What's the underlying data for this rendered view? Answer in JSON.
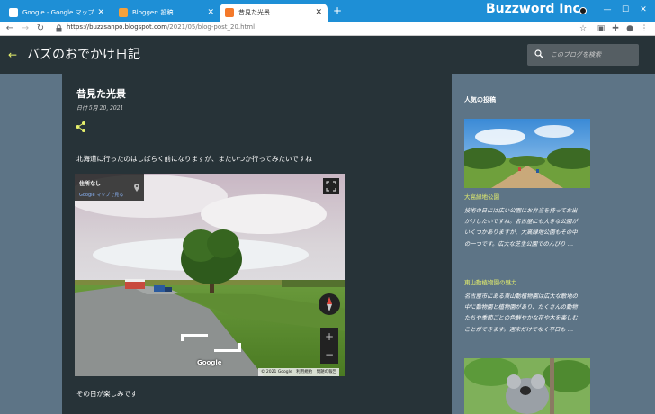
{
  "browser": {
    "tabs": [
      {
        "title": "Google - Google マップ",
        "active": false,
        "favicon_color": "#e8e8e8"
      },
      {
        "title": "Blogger: 投稿",
        "active": false,
        "favicon_color": "#f4a13b"
      },
      {
        "title": "昔見た光景",
        "active": true,
        "favicon_color": "#f4792a"
      }
    ],
    "new_tab": "+",
    "url_host": "https://buzzsanpo.blogspot.com",
    "url_path": "/2021/05/blog-post_20.html",
    "watermark": "Buzzword Inc.",
    "window_controls": {
      "minimize": "—",
      "maximize": "☐",
      "close": "✕"
    }
  },
  "blog": {
    "back": "←",
    "title": "バズのおでかけ日記",
    "search_placeholder": "このブログを検索"
  },
  "post": {
    "title": "昔見た光景",
    "date": "日付 5月 20, 2021",
    "text1": "北海道に行ったのはしばらく前になりますが、またいつか行ってみたいですね",
    "text2": "その日が楽しみです",
    "streetview": {
      "address": "住所なし",
      "maps_link": "Google マップで見る",
      "zoom_in": "+",
      "zoom_out": "−",
      "google_logo": "Google",
      "terms": "© 2021 Google　利用規約　問題の報告"
    }
  },
  "sidebar": {
    "heading": "人気の投稿",
    "posts": [
      {
        "title": "大高緑地公園",
        "snippet_lines": [
          "技術の日には広い公園にお弁当を持ってお出",
          "かけしたいですね。名古屋にも大きな公園が",
          "いくつかありますが、大高緑地公園もその中",
          "の一つです。広大な芝生公園でのんびり …"
        ]
      },
      {
        "title": "東山動植物園の魅力",
        "snippet_lines": [
          "名古屋市にある東山動植物園は広大な敷地の",
          "中に動物園と植物園があり、たくさんの動物",
          "たちや季節ごとの色鮮やかな花や木を楽しむ",
          "ことができます。週末だけでなく平日も …"
        ]
      }
    ]
  }
}
